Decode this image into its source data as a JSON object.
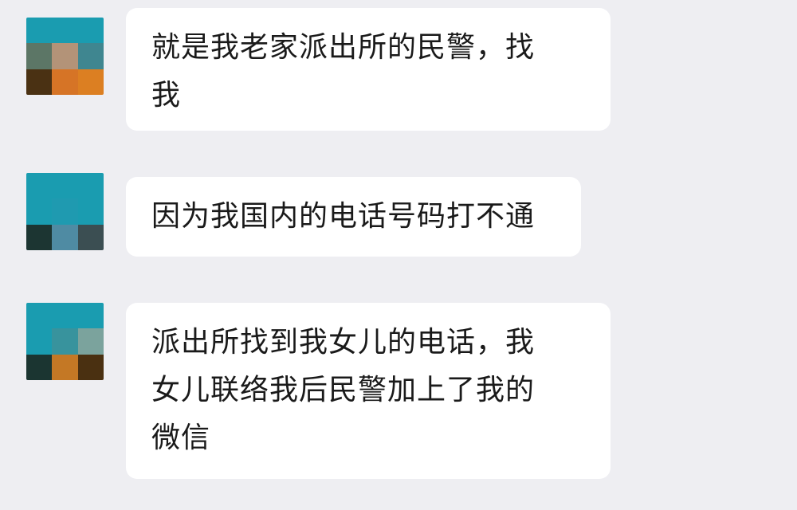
{
  "messages": [
    {
      "lines": [
        "就是我老家派出所的民警，找",
        "我"
      ],
      "avatar_colors": [
        "#1a9cb0",
        "#1a9cb0",
        "#1a9cb0",
        "#5c7666",
        "#b39378",
        "#3f8690",
        "#4a3113",
        "#d67426",
        "#dc7f22"
      ]
    },
    {
      "lines": [
        "因为我国内的电话号码打不通"
      ],
      "avatar_colors": [
        "#1a9cb0",
        "#1a9cb0",
        "#1a9cb0",
        "#1a9cb0",
        "#1f9ab0",
        "#1a9cb0",
        "#1c3532",
        "#4f8ba3",
        "#3b4e52"
      ]
    },
    {
      "lines": [
        "派出所找到我女儿的电话，我",
        "女儿联络我后民警加上了我的",
        "微信"
      ],
      "avatar_colors": [
        "#1a9cb0",
        "#1a9cb0",
        "#1a9cb0",
        "#1a9cb0",
        "#38939d",
        "#7ba39d",
        "#1b3531",
        "#c47825",
        "#4a3011"
      ]
    }
  ]
}
